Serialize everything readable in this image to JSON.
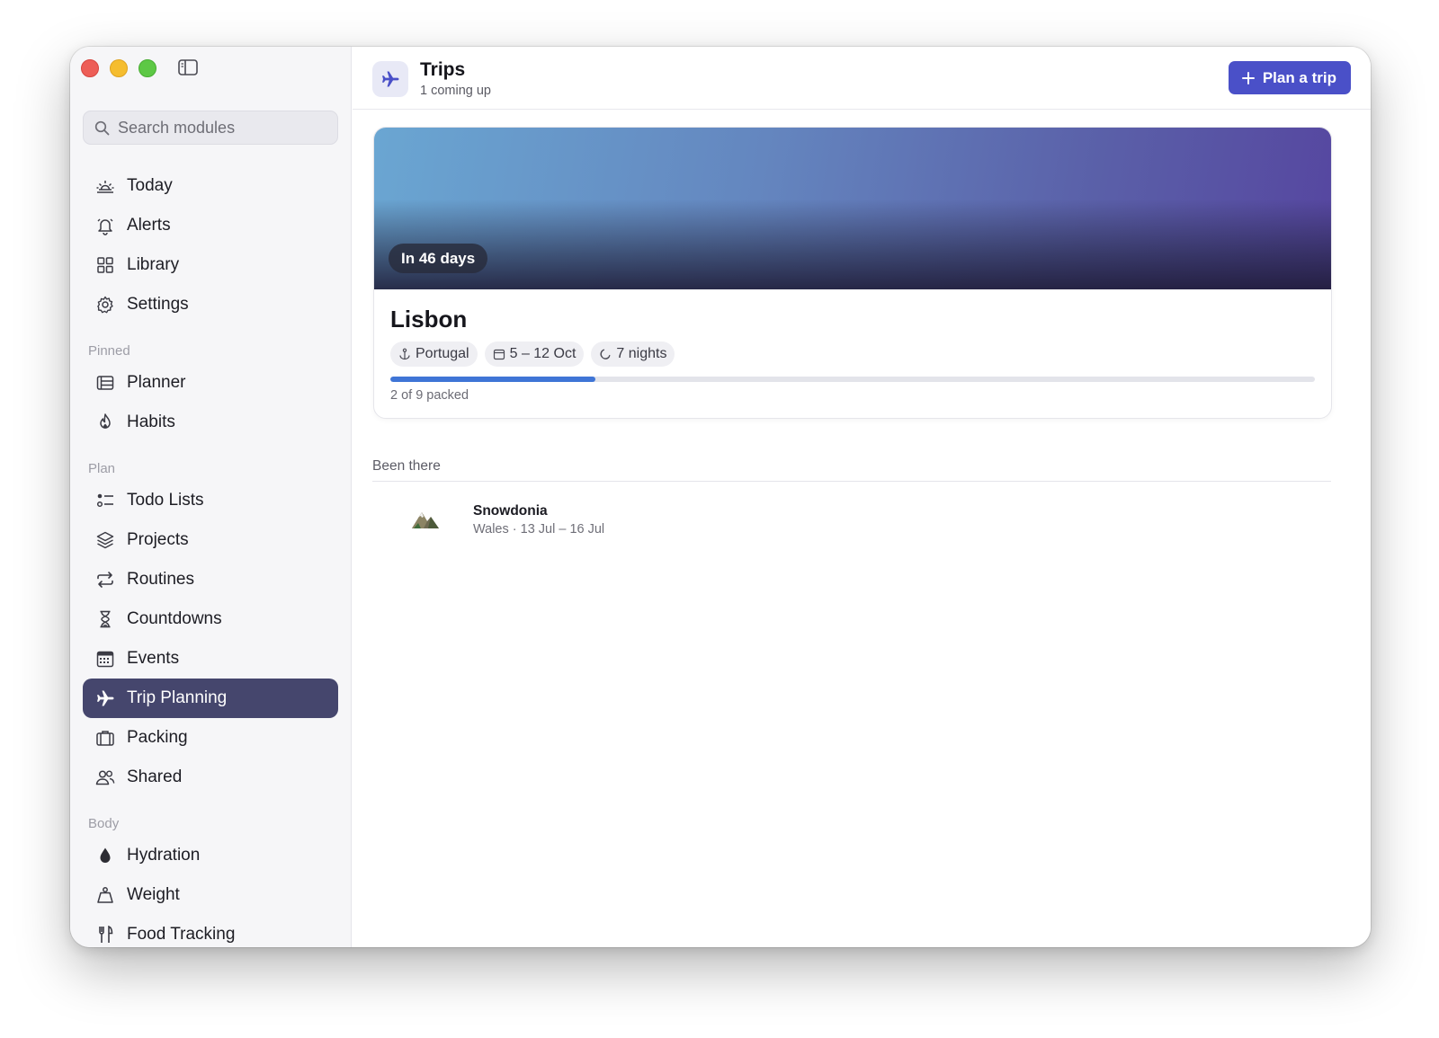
{
  "sidebar": {
    "search_placeholder": "Search modules",
    "main_items": [
      {
        "label": "Today",
        "icon": "sunrise-icon"
      },
      {
        "label": "Alerts",
        "icon": "bell-icon"
      },
      {
        "label": "Library",
        "icon": "grid-icon"
      },
      {
        "label": "Settings",
        "icon": "gear-icon"
      }
    ],
    "sections": [
      {
        "title": "Pinned",
        "items": [
          {
            "label": "Planner",
            "icon": "planner-icon"
          },
          {
            "label": "Habits",
            "icon": "flame-icon"
          }
        ]
      },
      {
        "title": "Plan",
        "items": [
          {
            "label": "Todo Lists",
            "icon": "checklist-icon"
          },
          {
            "label": "Projects",
            "icon": "layers-icon"
          },
          {
            "label": "Routines",
            "icon": "repeat-icon"
          },
          {
            "label": "Countdowns",
            "icon": "hourglass-icon"
          },
          {
            "label": "Events",
            "icon": "calendar-icon"
          },
          {
            "label": "Trip Planning",
            "icon": "airplane-icon",
            "active": true
          },
          {
            "label": "Packing",
            "icon": "suitcase-icon"
          },
          {
            "label": "Shared",
            "icon": "people-icon"
          }
        ]
      },
      {
        "title": "Body",
        "items": [
          {
            "label": "Hydration",
            "icon": "drop-icon"
          },
          {
            "label": "Weight",
            "icon": "scale-icon"
          },
          {
            "label": "Food Tracking",
            "icon": "fork-knife-icon"
          }
        ]
      }
    ]
  },
  "header": {
    "title": "Trips",
    "subtitle": "1 coming up",
    "plan_button": "Plan a trip",
    "accent_color": "#4a50c8"
  },
  "upcoming": {
    "countdown": "In 46 days",
    "name": "Lisbon",
    "country": "Portugal",
    "dates": "5 – 12 Oct",
    "nights": "7 nights",
    "packed_text": "2 of 9 packed",
    "packed_fraction": 0.222
  },
  "been_there": {
    "label": "Been there",
    "trips": [
      {
        "name": "Snowdonia",
        "meta": "Wales · 13 Jul – 16 Jul",
        "icon": "mountain-icon"
      }
    ]
  }
}
